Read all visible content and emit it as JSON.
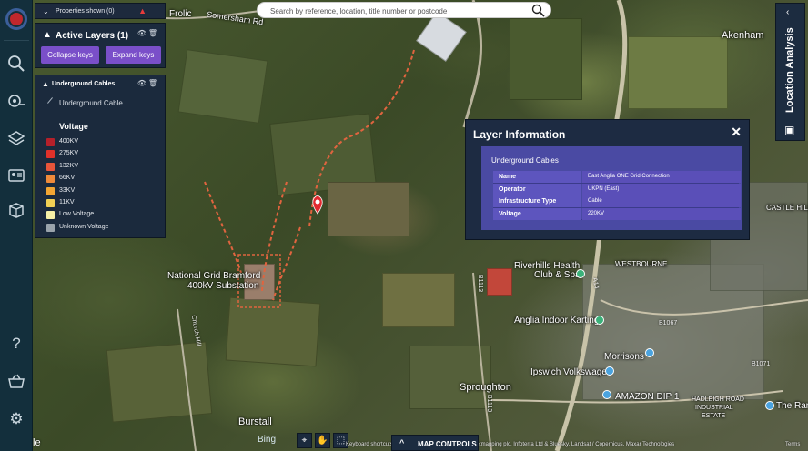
{
  "properties_bar": {
    "label": "Properties shown (0)"
  },
  "active_layers": {
    "title": "Active Layers (1)",
    "collapse_label": "Collapse keys",
    "expand_label": "Expand keys"
  },
  "underground_panel": {
    "title": "Underground Cables",
    "cable_label": "Underground Cable",
    "voltage_heading": "Voltage",
    "legend": [
      {
        "label": "400KV",
        "color": "#b5202a"
      },
      {
        "label": "275KV",
        "color": "#e0312a"
      },
      {
        "label": "132KV",
        "color": "#e8553a"
      },
      {
        "label": "66KV",
        "color": "#ef8a3a"
      },
      {
        "label": "33KV",
        "color": "#f2a533"
      },
      {
        "label": "11KV",
        "color": "#f1cf54"
      },
      {
        "label": "Low Voltage",
        "color": "#f6f0a6"
      },
      {
        "label": "Unknown Voltage",
        "color": "#9aa3ab"
      }
    ]
  },
  "search": {
    "placeholder": "Search by reference, location, title number or postcode"
  },
  "location_tab": {
    "label": "Location Analysis"
  },
  "popup": {
    "title": "Layer Information",
    "subtitle": "Underground Cables",
    "rows": [
      {
        "key": "Name",
        "value": "East Anglia ONE Grid Connection"
      },
      {
        "key": "Operator",
        "value": "UKPN (East)"
      },
      {
        "key": "Infrastructure Type",
        "value": "Cable"
      },
      {
        "key": "Voltage",
        "value": "220KV"
      }
    ]
  },
  "map_labels": {
    "frolic": "Frolic",
    "somersham_rd": "Somersham Rd",
    "akenham": "Akenham",
    "castle_hill": "CASTLE HILL",
    "westbourne": "WESTBOURNE",
    "riverhills": "Riverhills Health",
    "club_spa": "Club & Spa",
    "national_grid": "National Grid Bramford",
    "substation": "400kV Substation",
    "anglia_karting": "Anglia Indoor Karting",
    "morrisons": "Morrisons",
    "ipswich_vw": "Ipswich Volkswagen",
    "amazon": "AMAZON DIP 1",
    "sproughton": "Sproughton",
    "burstall": "Burstall",
    "hadleigh1": "HADLEIGH ROAD",
    "hadleigh2": "INDUSTRIAL",
    "hadleigh3": "ESTATE",
    "the_ran": "The Ran",
    "church_hill": "Church Hill",
    "b1113": "B1113",
    "b1067": "B1067",
    "a14": "A14",
    "b1071": "B1071",
    "b1113b": "B1113"
  },
  "bottom": {
    "bing": "Bing",
    "map_controls": "MAP CONTROLS",
    "attribution": "Keyboard shortcuts   Airbus, Bluesky, CNES / Airbus, Getmapping plc, Infoterra Ltd & Bluesky, Landsat / Copernicus, Maxar Technologies",
    "terms": "Terms",
    "e": "le"
  }
}
